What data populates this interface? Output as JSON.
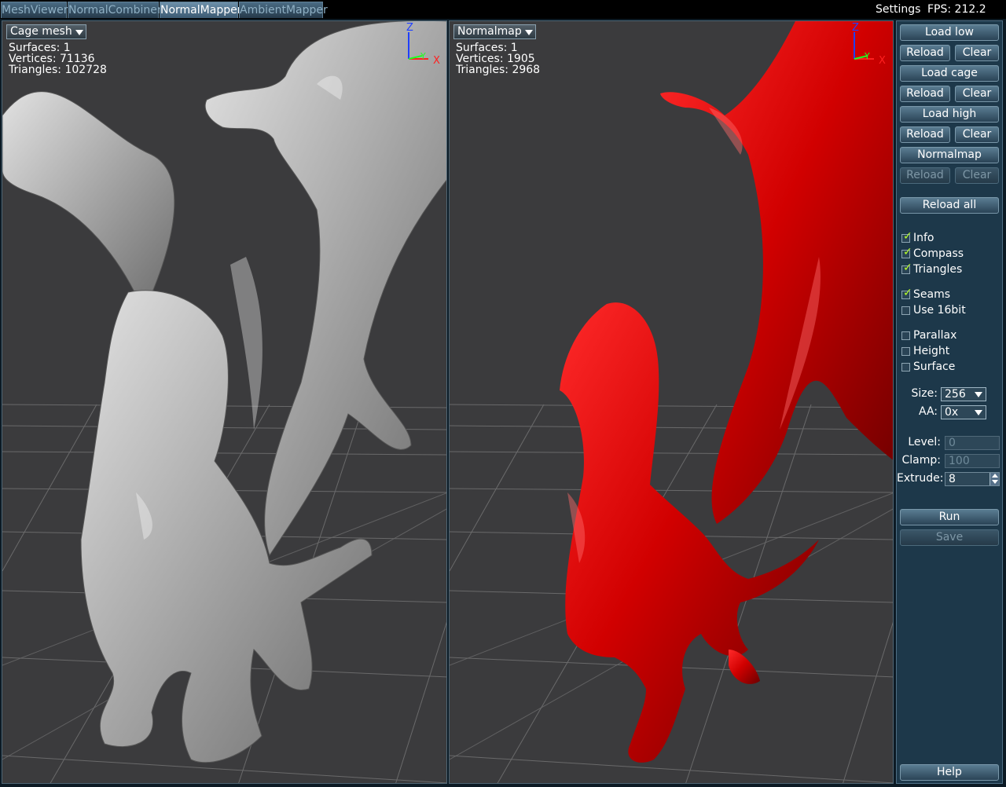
{
  "tabs": [
    {
      "label": "MeshViewer",
      "active": false
    },
    {
      "label": "NormalCombiner",
      "active": false
    },
    {
      "label": "NormalMapper",
      "active": true
    },
    {
      "label": "AmbientMapper",
      "active": false
    }
  ],
  "header": {
    "settings": "Settings",
    "fps": "FPS: 212.2"
  },
  "left_view": {
    "dropdown": "Cage mesh",
    "info": [
      "Surfaces: 1",
      "Vertices: 71136",
      "Triangles: 102728"
    ],
    "model_color": "#b9b9b9"
  },
  "right_view": {
    "dropdown": "Normalmap",
    "info": [
      "Surfaces: 1",
      "Vertices: 1905",
      "Triangles: 2968"
    ],
    "model_color": "#d10000"
  },
  "compass": {
    "z": "Z",
    "y": "Y",
    "x": "X"
  },
  "panel": {
    "load_low": "Load low",
    "load_cage": "Load cage",
    "load_high": "Load high",
    "normalmap": "Normalmap",
    "reload": "Reload",
    "clear": "Clear",
    "reload_all": "Reload all",
    "checks": {
      "info": {
        "label": "Info",
        "checked": true
      },
      "compass": {
        "label": "Compass",
        "checked": true
      },
      "triangles": {
        "label": "Triangles",
        "checked": true
      },
      "seams": {
        "label": "Seams",
        "checked": true
      },
      "use16bit": {
        "label": "Use 16bit",
        "checked": false
      },
      "parallax": {
        "label": "Parallax",
        "checked": false
      },
      "height": {
        "label": "Height",
        "checked": false
      },
      "surface": {
        "label": "Surface",
        "checked": false
      }
    },
    "size_label": "Size:",
    "size_value": "256",
    "aa_label": "AA:",
    "aa_value": "0x",
    "level_label": "Level:",
    "level_value": "0",
    "clamp_label": "Clamp:",
    "clamp_value": "100",
    "extrude_label": "Extrude:",
    "extrude_value": "8",
    "run": "Run",
    "save": "Save",
    "help": "Help"
  },
  "colors": {
    "accent": "#b8ff2a",
    "axis_x": "#ff2020",
    "axis_y": "#20ff20",
    "axis_z": "#2040ff"
  }
}
